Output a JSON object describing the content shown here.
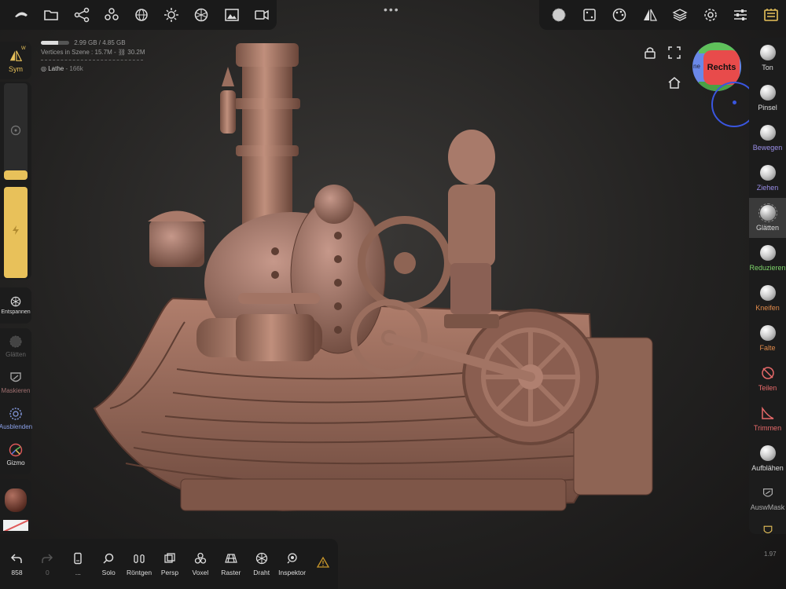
{
  "top_left_toolbar": [
    "nomad-logo-icon",
    "folder-icon",
    "scene-graph-icon",
    "topology-icon",
    "mesh-sphere-icon",
    "light-icon",
    "shading-icon",
    "background-image-icon",
    "camera-video-icon"
  ],
  "top_center": {
    "dots": "•••"
  },
  "top_right_toolbar": [
    "material-sphere-icon",
    "dice-icon",
    "palette-icon",
    "symmetry-icon",
    "layers-icon",
    "settings-icon",
    "sliders-icon",
    "menu-icon"
  ],
  "stats": {
    "memory": "2.99 GB / 4.85 GB",
    "memory_fraction": 0.62,
    "vertices_label": "Vertices in Szene :",
    "vertices_value": "15.7M",
    "secondary_value": "30.2M",
    "object_name": "Lathe",
    "object_count": "166k"
  },
  "left": {
    "sym_badge": "W",
    "sym_label": "Sym",
    "radius_fraction": 0.1,
    "strength_fraction": 1.0,
    "relax_label": "Entspannen",
    "tools": [
      {
        "label": "Glätten",
        "color": "#666666"
      },
      {
        "label": "Maskieren",
        "color": "#a07070"
      },
      {
        "label": "Ausblenden",
        "color": "#8aa0e8"
      },
      {
        "label": "Gizmo",
        "color": "#e0e0e0"
      }
    ]
  },
  "view": {
    "cube_face": "Rechts",
    "cube_left_face": "ne"
  },
  "right_tools": [
    {
      "label": "Ton",
      "color": "#dddddd"
    },
    {
      "label": "Pinsel",
      "color": "#dddddd"
    },
    {
      "label": "Bewegen",
      "color": "#9a8ee8"
    },
    {
      "label": "Ziehen",
      "color": "#9a8ee8"
    },
    {
      "label": "Glätten",
      "color": "#dddddd"
    },
    {
      "label": "Reduzieren",
      "color": "#7ed46a"
    },
    {
      "label": "Kneifen",
      "color": "#e08a4a"
    },
    {
      "label": "Falte",
      "color": "#e08a4a"
    },
    {
      "label": "Teilen",
      "color": "#e86a6a"
    },
    {
      "label": "Trimmen",
      "color": "#e86a6a"
    },
    {
      "label": "Aufblähen",
      "color": "#dddddd"
    },
    {
      "label": "AuswMask",
      "color": "#aaaaaa"
    }
  ],
  "bottom": [
    {
      "label": "858",
      "icon": "undo-icon"
    },
    {
      "label": "0",
      "icon": "redo-icon"
    },
    {
      "label": "...",
      "icon": "phone-icon"
    },
    {
      "label": "Solo",
      "icon": "search-icon"
    },
    {
      "label": "Röntgen",
      "icon": "xray-icon"
    },
    {
      "label": "Persp",
      "icon": "perspective-icon"
    },
    {
      "label": "Voxel",
      "icon": "voxel-icon"
    },
    {
      "label": "Raster",
      "icon": "grid-icon"
    },
    {
      "label": "Draht",
      "icon": "wireframe-icon"
    },
    {
      "label": "Inspektor",
      "icon": "inspector-icon"
    },
    {
      "label": "",
      "icon": "warning-icon"
    }
  ],
  "version": "1.97"
}
